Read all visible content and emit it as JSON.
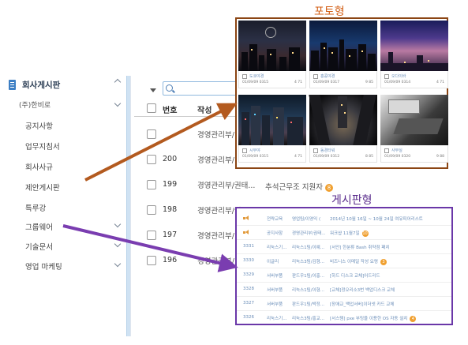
{
  "sidebar": {
    "title": "회사게시판",
    "company": "(주)한비로",
    "items": [
      {
        "label": "공지사항"
      },
      {
        "label": "업무지침서"
      },
      {
        "label": "회사사규"
      },
      {
        "label": "제안게시판"
      },
      {
        "label": "특루강"
      },
      {
        "label": "그룹웨어"
      },
      {
        "label": "기술문서"
      },
      {
        "label": "영업 마케팅"
      }
    ]
  },
  "board": {
    "header_number": "번호",
    "header_author": "작성",
    "rows": [
      {
        "num": "",
        "dept": "경영관리부/"
      },
      {
        "num": "200",
        "dept": "경영관리부/"
      },
      {
        "num": "199",
        "dept": "경영관리부/권태..."
      },
      {
        "num": "198",
        "dept": "경영관리부/권..."
      },
      {
        "num": "197",
        "dept": "경영관리부/"
      },
      {
        "num": "196",
        "dept": "경영관리부/"
      }
    ],
    "partial_title": "추석근무조 지원자",
    "partial_badge": "8"
  },
  "photo_panel": {
    "title": "포토형",
    "items": [
      {
        "title": "도쿄야경",
        "date": "01/09/09 0315",
        "counts": "4  71"
      },
      {
        "title": "홍콩야경",
        "date": "01/09/09 0317",
        "counts": "9  85"
      },
      {
        "title": "오다이바",
        "date": "01/09/09 0314",
        "counts": "4  71"
      },
      {
        "title": "시부야",
        "date": "01/09/09 0315",
        "counts": "4  71"
      },
      {
        "title": "동경타워",
        "date": "01/09/09 0312",
        "counts": "8  85"
      },
      {
        "title": "사무실",
        "date": "01/09/09 0320",
        "counts": "9  88"
      }
    ]
  },
  "board_panel": {
    "title": "게시판형",
    "rows": [
      {
        "a": "",
        "b": "전략교육",
        "c": "영업팀/이영익 (",
        "d": "2014년 10월 16일 ~ 10월 24일 여유피어리스트",
        "badge": "",
        "speaker": true
      },
      {
        "a": "",
        "b": "공지사항",
        "c": "경영관리부/권태...",
        "d": "워크샵 11월7일",
        "badge": "10",
        "speaker": true
      },
      {
        "a": "3331",
        "b": "리눅스기...",
        "c": "리눅스1팀/이예...",
        "d": "[서안] 한분류 Bash 취약점 패치",
        "badge": "",
        "speaker": false
      },
      {
        "a": "3330",
        "b": "이글리",
        "c": "리눅스3팀/김형...",
        "d": "비즈니스 이메일 작성 요령",
        "badge": "3",
        "speaker": false
      },
      {
        "a": "3329",
        "b": "서버부품",
        "c": "판드우1팀/이홍...",
        "d": "[하드 디스크 교체]어드리드",
        "badge": "",
        "speaker": false
      },
      {
        "a": "3328",
        "b": "서버부품",
        "c": "리눅스1팀/이형...",
        "d": "[교체]정오리소3번 백업디스크 교체",
        "badge": "",
        "speaker": false
      },
      {
        "a": "3327",
        "b": "서버부품",
        "c": "판드우1팀/박정...",
        "d": "[장애교_백업서버]이더넷 카드 교체",
        "badge": "",
        "speaker": false
      },
      {
        "a": "3326",
        "b": "리눅스기...",
        "c": "리눅스3팀/홍교...",
        "d": "[서스템] pxe 부팅을 이용한 OS 자동 설치",
        "badge": "4",
        "speaker": false
      }
    ]
  },
  "colors": {
    "photo_border": "#8b4513",
    "photo_arrow": "#b35a1f",
    "board_border": "#6a37a8",
    "board_arrow": "#7a3db0"
  }
}
